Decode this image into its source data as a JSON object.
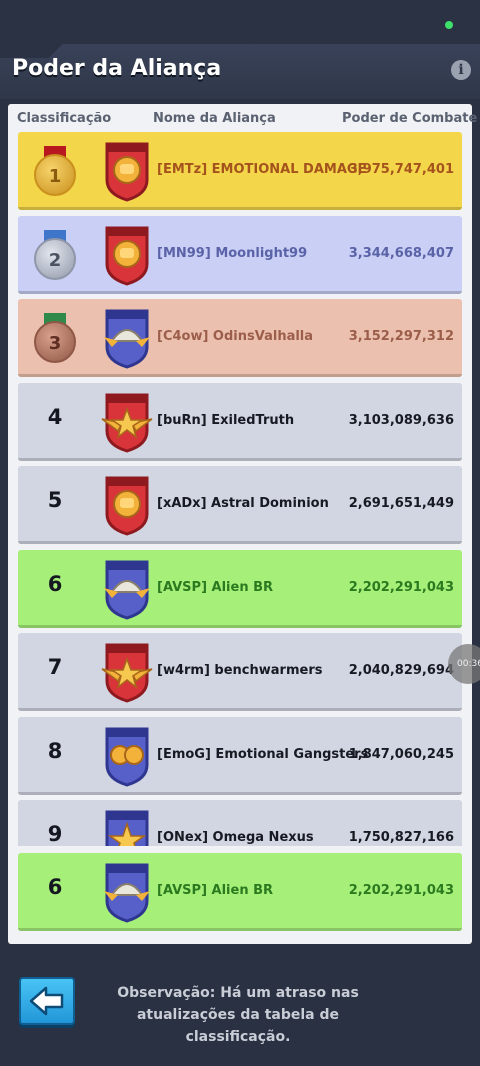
{
  "header": {
    "title": "Poder da Aliança"
  },
  "columns": {
    "rank": "Classificação",
    "name": "Nome da Aliança",
    "power": "Poder de Combate"
  },
  "rows": [
    {
      "rank": "1",
      "name": "[EMTz] EMOTIONAL DAMAGE",
      "power": "3,975,747,401",
      "bg": "#f3d64a",
      "text_color": "#a5531c",
      "medal": "gold",
      "emblem": "red-fist"
    },
    {
      "rank": "2",
      "name": "[MN99] Moonlight99",
      "power": "3,344,668,407",
      "bg": "#c9cff5",
      "text_color": "#5a63a8",
      "medal": "silver",
      "emblem": "red-fist"
    },
    {
      "rank": "3",
      "name": "[C4ow] OdinsValhalla",
      "power": "3,152,297,312",
      "bg": "#ecc0ae",
      "text_color": "#9b5e4a",
      "medal": "bronze",
      "emblem": "blue-helmet"
    },
    {
      "rank": "4",
      "name": "[buRn] ExiledTruth",
      "power": "3,103,089,636",
      "bg": "#d2d6e2",
      "text_color": "#171a22",
      "medal": "",
      "emblem": "red-wings"
    },
    {
      "rank": "5",
      "name": "[xADx] Astral Dominion",
      "power": "2,691,651,449",
      "bg": "#d2d6e2",
      "text_color": "#171a22",
      "medal": "",
      "emblem": "red-fist"
    },
    {
      "rank": "6",
      "name": "[AVSP] Alien BR",
      "power": "2,202,291,043",
      "bg": "#a6f07a",
      "text_color": "#2b7a1f",
      "medal": "",
      "emblem": "blue-helmet"
    },
    {
      "rank": "7",
      "name": "[w4rm] benchwarmers",
      "power": "2,040,829,694",
      "bg": "#d2d6e2",
      "text_color": "#171a22",
      "medal": "",
      "emblem": "red-wings"
    },
    {
      "rank": "8",
      "name": "[EmoG] Emotional Gangsters",
      "power": "1,847,060,245",
      "bg": "#d2d6e2",
      "text_color": "#171a22",
      "medal": "",
      "emblem": "blue-fists"
    },
    {
      "rank": "9",
      "name": "[ONex] Omega Nexus",
      "power": "1,750,827,166",
      "bg": "#d2d6e2",
      "text_color": "#171a22",
      "medal": "",
      "emblem": "blue-star"
    }
  ],
  "pinned": {
    "rank": "6",
    "name": "[AVSP] Alien BR",
    "power": "2,202,291,043",
    "bg": "#a6f07a",
    "text_color": "#2b7a1f",
    "emblem": "blue-helmet"
  },
  "footer": {
    "note": "Observação: Há um atraso nas atualizações da tabela de classificação."
  },
  "overlay": {
    "timer": "00:36"
  }
}
